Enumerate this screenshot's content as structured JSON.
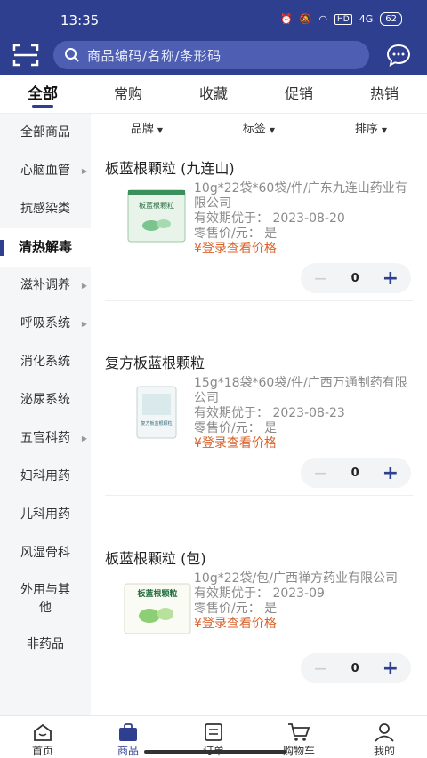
{
  "status": {
    "time": "13:35",
    "network": "4G",
    "battery": "62"
  },
  "search": {
    "placeholder": "商品编码/名称/条形码"
  },
  "tabs": [
    {
      "label": "全部",
      "active": true
    },
    {
      "label": "常购"
    },
    {
      "label": "收藏"
    },
    {
      "label": "促销"
    },
    {
      "label": "热销"
    }
  ],
  "sidebar": {
    "items": [
      {
        "label": "全部商品"
      },
      {
        "label": "心脑血管",
        "expandable": true
      },
      {
        "label": "抗感染类"
      },
      {
        "label": "清热解毒",
        "active": true
      },
      {
        "label": "滋补调养",
        "expandable": true
      },
      {
        "label": "呼吸系统",
        "expandable": true
      },
      {
        "label": "消化系统"
      },
      {
        "label": "泌尿系统"
      },
      {
        "label": "五官科药",
        "expandable": true
      },
      {
        "label": "妇科用药"
      },
      {
        "label": "儿科用药"
      },
      {
        "label": "风湿骨科"
      },
      {
        "label": "外用与其他"
      },
      {
        "label": "非药品"
      }
    ]
  },
  "filters": [
    {
      "label": "品牌"
    },
    {
      "label": "标签"
    },
    {
      "label": "排序"
    }
  ],
  "products": [
    {
      "name": "板蓝根颗粒 (九连山)",
      "spec": "10g*22袋*60袋/件/广东九连山药业有限公司",
      "expiry": "有效期优于： 2023-08-20",
      "retail": "零售价/元： 是",
      "price_login": "¥登录查看价格",
      "qty": "0",
      "package_label": "板蓝根颗粒"
    },
    {
      "name": "复方板蓝根颗粒",
      "spec": "15g*18袋*60袋/件/广西万通制药有限公司",
      "expiry": "有效期优于： 2023-08-23",
      "retail": "零售价/元： 是",
      "price_login": "¥登录查看价格",
      "qty": "0",
      "package_label": "复方板蓝根颗粒"
    },
    {
      "name": "板蓝根颗粒 (包)",
      "spec": "10g*22袋/包/广西禅方药业有限公司",
      "expiry": "有效期优于： 2023-09",
      "retail": "零售价/元： 是",
      "price_login": "¥登录查看价格",
      "qty": "0",
      "package_label": "板蓝根颗粒"
    }
  ],
  "bottom_nav": [
    {
      "label": "首页",
      "icon": "home-icon"
    },
    {
      "label": "商品",
      "icon": "bag-icon",
      "active": true
    },
    {
      "label": "订单",
      "icon": "order-icon"
    },
    {
      "label": "购物车",
      "icon": "cart-icon"
    },
    {
      "label": "我的",
      "icon": "user-icon"
    }
  ],
  "colors": {
    "primary": "#2f3f8f",
    "accent": "#d9622b"
  }
}
